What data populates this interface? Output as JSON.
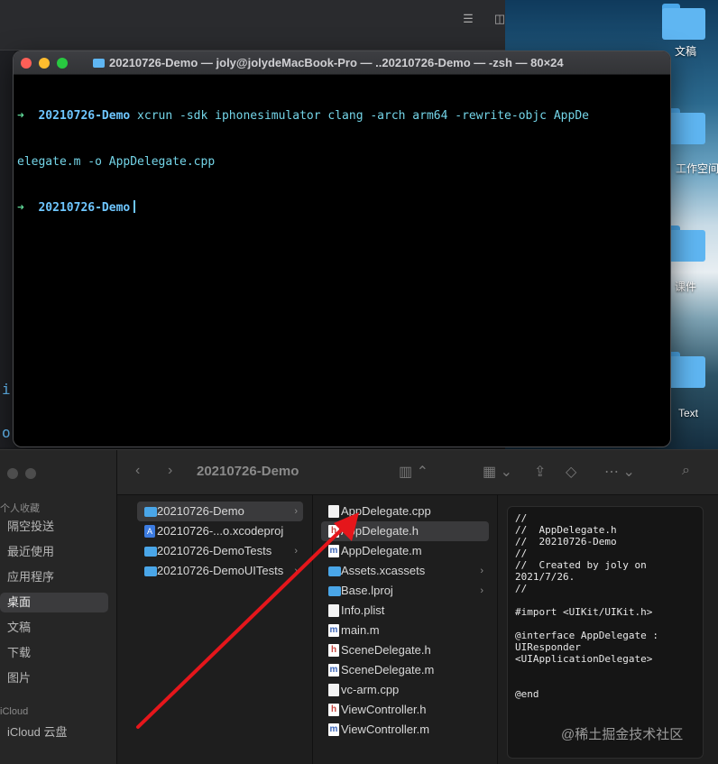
{
  "back_window": {
    "icons": [
      "lines-icon",
      "sidebar-icon"
    ]
  },
  "desktop": {
    "items": [
      {
        "label": "文稿"
      },
      {
        "label": "工作空间"
      },
      {
        "label": ""
      },
      {
        "label": "课件"
      },
      {
        "label": "Text"
      }
    ]
  },
  "terminal": {
    "title": "20210726-Demo — joly@jolydeMacBook-Pro — ..20210726-Demo — -zsh — 80×24",
    "lines": [
      {
        "arrow": "➜",
        "dir": "20210726-Demo",
        "text": " xcrun -sdk iphonesimulator clang -arch arm64 -rewrite-objc AppDe"
      },
      {
        "arrow": "",
        "dir": "",
        "text": "elegate.m -o AppDelegate.cpp"
      },
      {
        "arrow": "➜",
        "dir": "20210726-Demo",
        "text": ""
      }
    ],
    "left_glyphs": [
      "i",
      "o"
    ]
  },
  "finder": {
    "title": "20210726-Demo",
    "sidebar": {
      "favorites_header": "个人收藏",
      "items": [
        {
          "label": "隔空投送",
          "icon": "airdrop-icon"
        },
        {
          "label": "最近使用",
          "icon": "clock-icon"
        },
        {
          "label": "应用程序",
          "icon": "apps-icon"
        },
        {
          "label": "桌面",
          "icon": "desktop-icon",
          "active": true
        },
        {
          "label": "文稿",
          "icon": "doc-icon"
        },
        {
          "label": "下载",
          "icon": "download-icon"
        },
        {
          "label": "图片",
          "icon": "photo-icon"
        }
      ],
      "icloud_header": "iCloud",
      "icloud_items": [
        {
          "label": "iCloud 云盘",
          "icon": "cloud-icon"
        }
      ]
    },
    "column1": [
      {
        "label": "20210726-Demo",
        "icon": "folder",
        "chevron": true,
        "selected": true
      },
      {
        "label": "20210726-...o.xcodeproj",
        "icon": "proj",
        "chevron": false
      },
      {
        "label": "20210726-DemoTests",
        "icon": "folder",
        "chevron": true
      },
      {
        "label": "20210726-DemoUITests",
        "icon": "folder",
        "chevron": true
      }
    ],
    "column2": [
      {
        "label": "AppDelegate.cpp",
        "icon": "doc"
      },
      {
        "label": "AppDelegate.h",
        "icon": "h",
        "selected": true
      },
      {
        "label": "AppDelegate.m",
        "icon": "m"
      },
      {
        "label": "Assets.xcassets",
        "icon": "folder",
        "chevron": true
      },
      {
        "label": "Base.lproj",
        "icon": "folder",
        "chevron": true
      },
      {
        "label": "Info.plist",
        "icon": "doc"
      },
      {
        "label": "main.m",
        "icon": "m"
      },
      {
        "label": "SceneDelegate.h",
        "icon": "h"
      },
      {
        "label": "SceneDelegate.m",
        "icon": "m"
      },
      {
        "label": "vc-arm.cpp",
        "icon": "doc"
      },
      {
        "label": "ViewController.h",
        "icon": "h"
      },
      {
        "label": "ViewController.m",
        "icon": "m"
      }
    ],
    "preview_text": "//\n//  AppDelegate.h\n//  20210726-Demo\n//\n//  Created by joly on\n2021/7/26.\n//\n\n#import <UIKit/UIKit.h>\n\n@interface AppDelegate :\nUIResponder\n<UIApplicationDelegate>\n\n\n@end",
    "watermark": "@稀土掘金技术社区"
  },
  "colors": {
    "arrow": "#e5161b",
    "prompt_arrow": "#5fd697",
    "prompt_dir": "#6ec6ff",
    "folder": "#4aa6e8"
  }
}
